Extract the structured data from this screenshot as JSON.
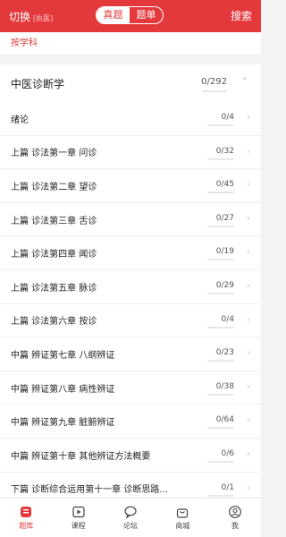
{
  "header": {
    "switch_label": "切换",
    "switch_tag": "[执医]",
    "segments": [
      "真题",
      "题单"
    ],
    "active_segment": 0,
    "search_label": "搜索",
    "accent": "#e4393c"
  },
  "filter": {
    "label": "按学科"
  },
  "subject": {
    "name": "中医诊断学",
    "count": "0/292",
    "expanded": true
  },
  "chapters": [
    {
      "label": "绪论",
      "count": "0/4"
    },
    {
      "label": "上篇 诊法第一章 问诊",
      "count": "0/32"
    },
    {
      "label": "上篇 诊法第二章 望诊",
      "count": "0/45"
    },
    {
      "label": "上篇 诊法第三章 舌诊",
      "count": "0/27"
    },
    {
      "label": "上篇 诊法第四章 闻诊",
      "count": "0/19"
    },
    {
      "label": "上篇 诊法第五章 脉诊",
      "count": "0/29"
    },
    {
      "label": "上篇 诊法第六章 按诊",
      "count": "0/4"
    },
    {
      "label": "中篇 辨证第七章 八纲辨证",
      "count": "0/23"
    },
    {
      "label": "中篇 辨证第八章 病性辨证",
      "count": "0/38"
    },
    {
      "label": "中篇 辨证第九章 脏腑辨证",
      "count": "0/64"
    },
    {
      "label": "中篇 辨证第十章 其他辨证方法概要",
      "count": "0/6"
    },
    {
      "label": "下篇 诊断综合运用第十一章 诊断思路...",
      "count": "0/1"
    }
  ],
  "tabs": [
    {
      "label": "题库",
      "icon": "question-bank-icon",
      "active": true
    },
    {
      "label": "课程",
      "icon": "course-play-icon",
      "active": false
    },
    {
      "label": "论坛",
      "icon": "forum-chat-icon",
      "active": false
    },
    {
      "label": "商城",
      "icon": "shop-bag-icon",
      "active": false
    },
    {
      "label": "我",
      "icon": "profile-icon",
      "active": false
    }
  ]
}
